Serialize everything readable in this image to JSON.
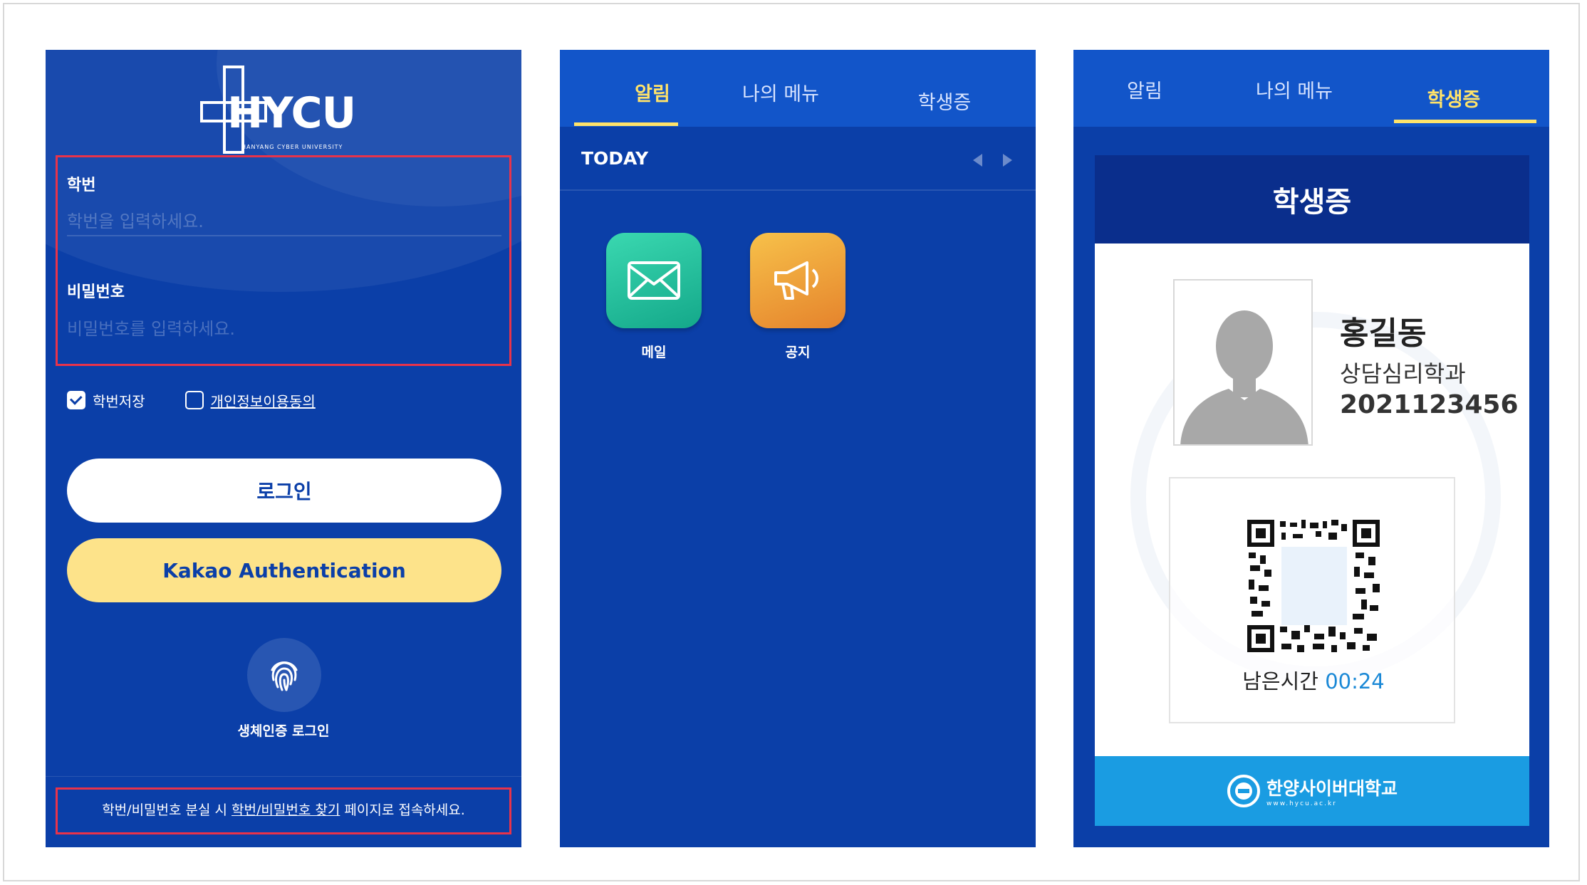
{
  "login": {
    "logo_text": "HYCU",
    "logo_subtitle": "HANYANG CYBER UNIVERSITY",
    "id_label": "학번",
    "id_placeholder": "학번을 입력하세요.",
    "pw_label": "비밀번호",
    "pw_placeholder": "비밀번호를 입력하세요.",
    "save_id_label": "학번저장",
    "save_id_checked": true,
    "privacy_label": "개인정보이용동의",
    "privacy_checked": false,
    "login_button": "로그인",
    "kakao_button": "Kakao Authentication",
    "bio_label": "생체인증 로그인",
    "help_prefix": "학번/비밀번호 분실 시 ",
    "help_link": "학번/비밀번호 찾기",
    "help_suffix": " 페이지로 접속하세요."
  },
  "tabs": [
    "알림",
    "나의 메뉴",
    "학생증"
  ],
  "notifications": {
    "today_label": "TODAY",
    "apps": [
      {
        "label": "메일",
        "icon": "mail-icon"
      },
      {
        "label": "공지",
        "icon": "megaphone-icon"
      }
    ]
  },
  "student_card": {
    "title": "학생증",
    "name": "홍길동",
    "department": "상담심리학과",
    "student_id": "2021123456",
    "remaining_label": "남은시간",
    "remaining_time": "00:24",
    "university": "한양사이버대학교",
    "url": "www.hycu.ac.kr"
  },
  "colors": {
    "brand_blue": "#0b3fa8",
    "tab_blue": "#1255c9",
    "accent_yellow": "#ffe36a",
    "kakao_yellow": "#fde38a",
    "highlight_red": "#e8334a",
    "card_footer": "#1a9ce2"
  }
}
